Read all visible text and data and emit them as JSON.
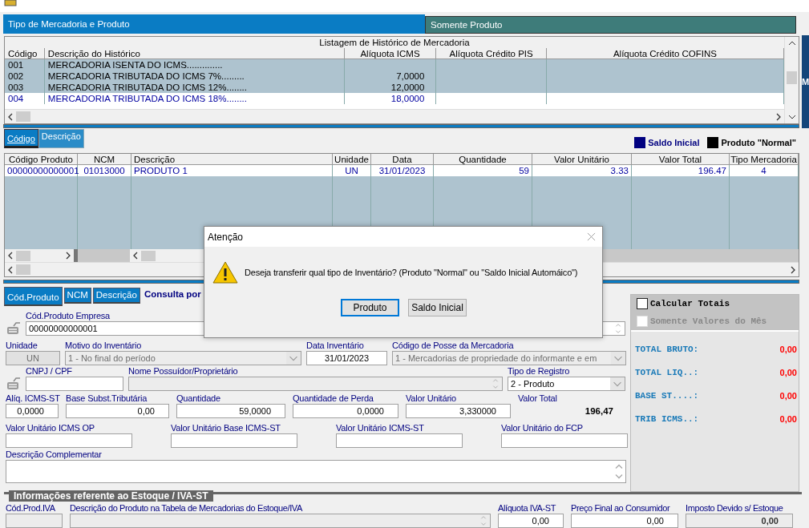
{
  "panel_tabs": [
    {
      "label": "Tipo de Mercadoria e Produto",
      "selected": true
    },
    {
      "label": "Somente Produto",
      "selected": false
    }
  ],
  "edge_label": "M",
  "history_table": {
    "title": "Listagem de Histórico de Mercadoria",
    "columns": [
      "Código",
      "Descrição do Histórico",
      "Alíquota ICMS",
      "Alíquota Crédito PIS",
      "Alíquota Crédito COFINS"
    ],
    "rows": [
      {
        "code": "001",
        "description": "MERCADORIA ISENTA DO ICMS..............",
        "selected": false
      },
      {
        "code": "002",
        "description": "MERCADORIA TRIBUTADA DO ICMS 7%.........",
        "icms": "7,0000",
        "selected": false
      },
      {
        "code": "003",
        "description": "MERCADORIA TRIBUTADA DO ICMS 12%........",
        "icms": "12,0000",
        "selected": false
      },
      {
        "code": "004",
        "description": "MERCADORIA TRIBUTADA DO ICMS 18%........",
        "icms": "18,0000",
        "selected": true
      }
    ]
  },
  "sort_tabs": [
    {
      "label": "Código",
      "selected": true
    },
    {
      "label": "Descrição",
      "selected": false
    }
  ],
  "legend": [
    {
      "label": "Saldo Inicial",
      "color": "#000080"
    },
    {
      "label": "Produto \"Normal\"",
      "color": "#000000"
    }
  ],
  "product_table": {
    "columns": [
      "Código Produto",
      "NCM",
      "Descrição",
      "Unidade",
      "Data",
      "Quantidade",
      "Valor Unitário",
      "Valor Total",
      "Tipo Mercadoria"
    ],
    "rows": [
      {
        "code": "00000000000001",
        "ncm": "01013000",
        "description": "PRODUTO 1",
        "unit": "UN",
        "date": "31/01/2023",
        "quantity": "59",
        "unit_value": "3.33",
        "total_value": "196.47",
        "type": "4",
        "selected": true
      }
    ]
  },
  "search_tabs": [
    {
      "label": "Cód.Produto",
      "selected": true
    },
    {
      "label": "NCM",
      "selected": false
    },
    {
      "label": "Descrição",
      "selected": false
    }
  ],
  "search_label": "Consulta por",
  "form": [
    {
      "fields": [
        {
          "kind": "lookup",
          "label": "Cód.Produto Empresa",
          "value": "00000000000001",
          "disabled": false
        }
      ]
    },
    {
      "fields": [
        {
          "kind": "centered",
          "label": "Unidade",
          "value": "UN",
          "disabled": true
        },
        {
          "kind": "combo",
          "label": "Motivo do Inventário",
          "value": "1 - No final do período",
          "disabled": true
        },
        {
          "kind": "centered",
          "label": "Data Inventário",
          "value": "31/01/2023",
          "disabled": false
        },
        {
          "kind": "combo",
          "label": "Código de Posse da Mercadoria",
          "value": "1 - Mercadorias de propriedade do informante e em",
          "disabled": true
        }
      ]
    },
    {
      "fields": [
        {
          "kind": "lookup_short",
          "label": "CNPJ / CPF",
          "disabled": false
        },
        {
          "kind": "spin",
          "label": "Nome Possuídor/Proprietário",
          "disabled": true
        },
        {
          "kind": "combo",
          "label": "Tipo de Registro",
          "value": "2 - Produto",
          "disabled": false
        }
      ]
    },
    {
      "fields": [
        {
          "kind": "number",
          "label": "Alíq. ICMS-ST",
          "value": "0,0000",
          "disabled": false
        },
        {
          "kind": "number",
          "label": "Base Subst.Tributária",
          "value": "0,00",
          "disabled": false
        },
        {
          "kind": "number",
          "label": "Quantidade",
          "value": "59,0000",
          "disabled": false
        },
        {
          "kind": "number",
          "label": "Quantidade de Perda",
          "value": "0,0000",
          "disabled": false
        },
        {
          "kind": "number",
          "label": "Valor Unitário",
          "value": "3,330000",
          "disabled": false
        },
        {
          "kind": "readout",
          "label": "Valor Total",
          "value": "196,47"
        }
      ]
    },
    {
      "fields": [
        {
          "kind": "number",
          "label": "Valor Unitário ICMS OP",
          "disabled": false
        },
        {
          "kind": "number",
          "label": "Valor Unitário Base ICMS-ST",
          "disabled": false
        },
        {
          "kind": "number",
          "label": "Valor Unitário ICMS-ST",
          "disabled": false
        },
        {
          "kind": "number",
          "label": "Valor Unitário do FCP",
          "disabled": false
        }
      ]
    },
    {
      "fields": [
        {
          "kind": "memo",
          "label": "Descrição Complementar",
          "disabled": false
        }
      ]
    }
  ],
  "totals_panel": {
    "options": [
      {
        "label": "Calcular Totais",
        "checked": false,
        "disabled": false
      },
      {
        "label": "Somente Valores do Mês",
        "checked": false,
        "disabled": true
      }
    ],
    "totals": [
      {
        "label": "TOTAL BRUTO:",
        "value": "0,00"
      },
      {
        "label": "TOTAL LIQ..:",
        "value": "0,00"
      },
      {
        "label": "BASE ST....:",
        "value": "0,00"
      },
      {
        "label": "TRIB ICMS..:",
        "value": "0,00"
      }
    ]
  },
  "stock_section": {
    "title": "Informações referente ao Estoque / IVA-ST",
    "fields": [
      {
        "kind": "text",
        "label": "Cód.Prod.IVA",
        "disabled": true
      },
      {
        "kind": "spin",
        "label": "Descrição do Produto na Tabela de Mercadorias do Estoque/IVA",
        "disabled": true
      },
      {
        "kind": "number",
        "label": "Alíquota IVA-ST",
        "value": "0,00",
        "disabled": false
      },
      {
        "kind": "number",
        "label": "Preço Final ao Consumidor",
        "value": "0,00",
        "disabled": false
      },
      {
        "kind": "number",
        "label": "Imposto Devido s/ Estoque",
        "value": "0,00",
        "disabled": true
      }
    ]
  },
  "dialog": {
    "title": "Atenção",
    "message": "Deseja transferir qual tipo de Inventário? (Produto \"Normal\" ou \"Saldo Inicial Automáico\")",
    "buttons": [
      {
        "label": "Produto",
        "selected": true
      },
      {
        "label": "Saldo Inicial",
        "selected": false
      }
    ]
  }
}
